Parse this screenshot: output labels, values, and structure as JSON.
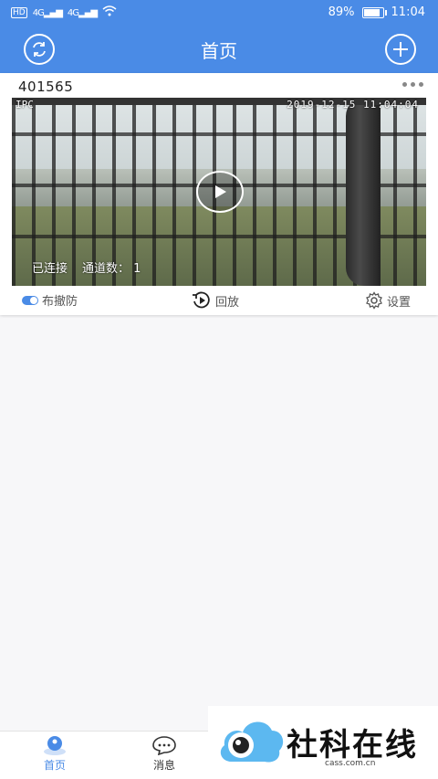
{
  "status_bar": {
    "network_left": "4G",
    "network_right": "4G",
    "battery": "89%",
    "time": "11:04"
  },
  "header": {
    "title": "首页"
  },
  "device": {
    "id": "401565",
    "osd_label": "IPC",
    "osd_timestamp": "2019-12-15 11:04:04",
    "connection_status": "已连接",
    "channel_label": "通道数：",
    "channel_count": "1"
  },
  "card_actions": {
    "arm_label": "布撤防",
    "playback_label": "回放",
    "settings_label": "设置"
  },
  "tabs": [
    {
      "label": "首页",
      "icon": "home-icon",
      "active": true
    },
    {
      "label": "消息",
      "icon": "message-icon",
      "active": false
    }
  ],
  "watermark": {
    "text": "社科在线",
    "url": "cass.com.cn"
  },
  "colors": {
    "accent": "#4a8be6"
  }
}
